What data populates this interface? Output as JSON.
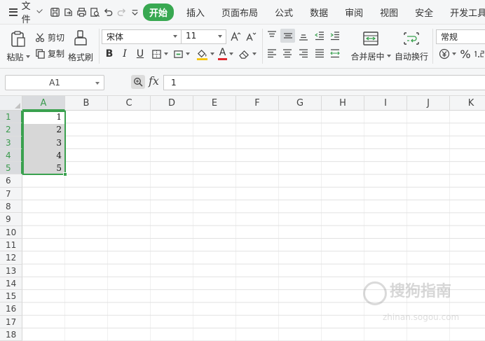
{
  "menubar": {
    "file_label": "文件",
    "tabs": [
      {
        "label": "开始",
        "active": true
      },
      {
        "label": "插入",
        "active": false
      },
      {
        "label": "页面布局",
        "active": false
      },
      {
        "label": "公式",
        "active": false
      },
      {
        "label": "数据",
        "active": false
      },
      {
        "label": "审阅",
        "active": false
      },
      {
        "label": "视图",
        "active": false
      },
      {
        "label": "安全",
        "active": false
      },
      {
        "label": "开发工具",
        "active": false
      }
    ]
  },
  "ribbon": {
    "paste_label": "粘贴",
    "cut_label": "剪切",
    "copy_label": "复制",
    "format_painter_label": "格式刷",
    "font_name": "宋体",
    "font_size": "11",
    "bold": "B",
    "italic": "I",
    "underline": "U",
    "font_color_letter": "A",
    "merge_center_label": "合并居中",
    "wrap_text_label": "自动换行",
    "number_format": "常规",
    "percent": "%"
  },
  "formula_bar": {
    "cell_ref": "A1",
    "fx_label": "fx",
    "formula_value": "1"
  },
  "grid": {
    "columns": [
      "A",
      "B",
      "C",
      "D",
      "E",
      "F",
      "G",
      "H",
      "I",
      "J",
      "K"
    ],
    "rows": [
      "1",
      "2",
      "3",
      "4",
      "5",
      "6",
      "7",
      "8",
      "9",
      "10",
      "11",
      "12",
      "13",
      "14",
      "15",
      "16",
      "17",
      "18"
    ],
    "selected_column": "A",
    "selected_rows": [
      "1",
      "2",
      "3",
      "4",
      "5"
    ],
    "cells_A": [
      "1",
      "2",
      "3",
      "4",
      "5"
    ]
  },
  "watermark": {
    "title": "搜狗指南",
    "url": "zhinan.sogou.com"
  },
  "colors": {
    "accent_green": "#3aa14f",
    "tab_active_bg": "#38a851"
  }
}
